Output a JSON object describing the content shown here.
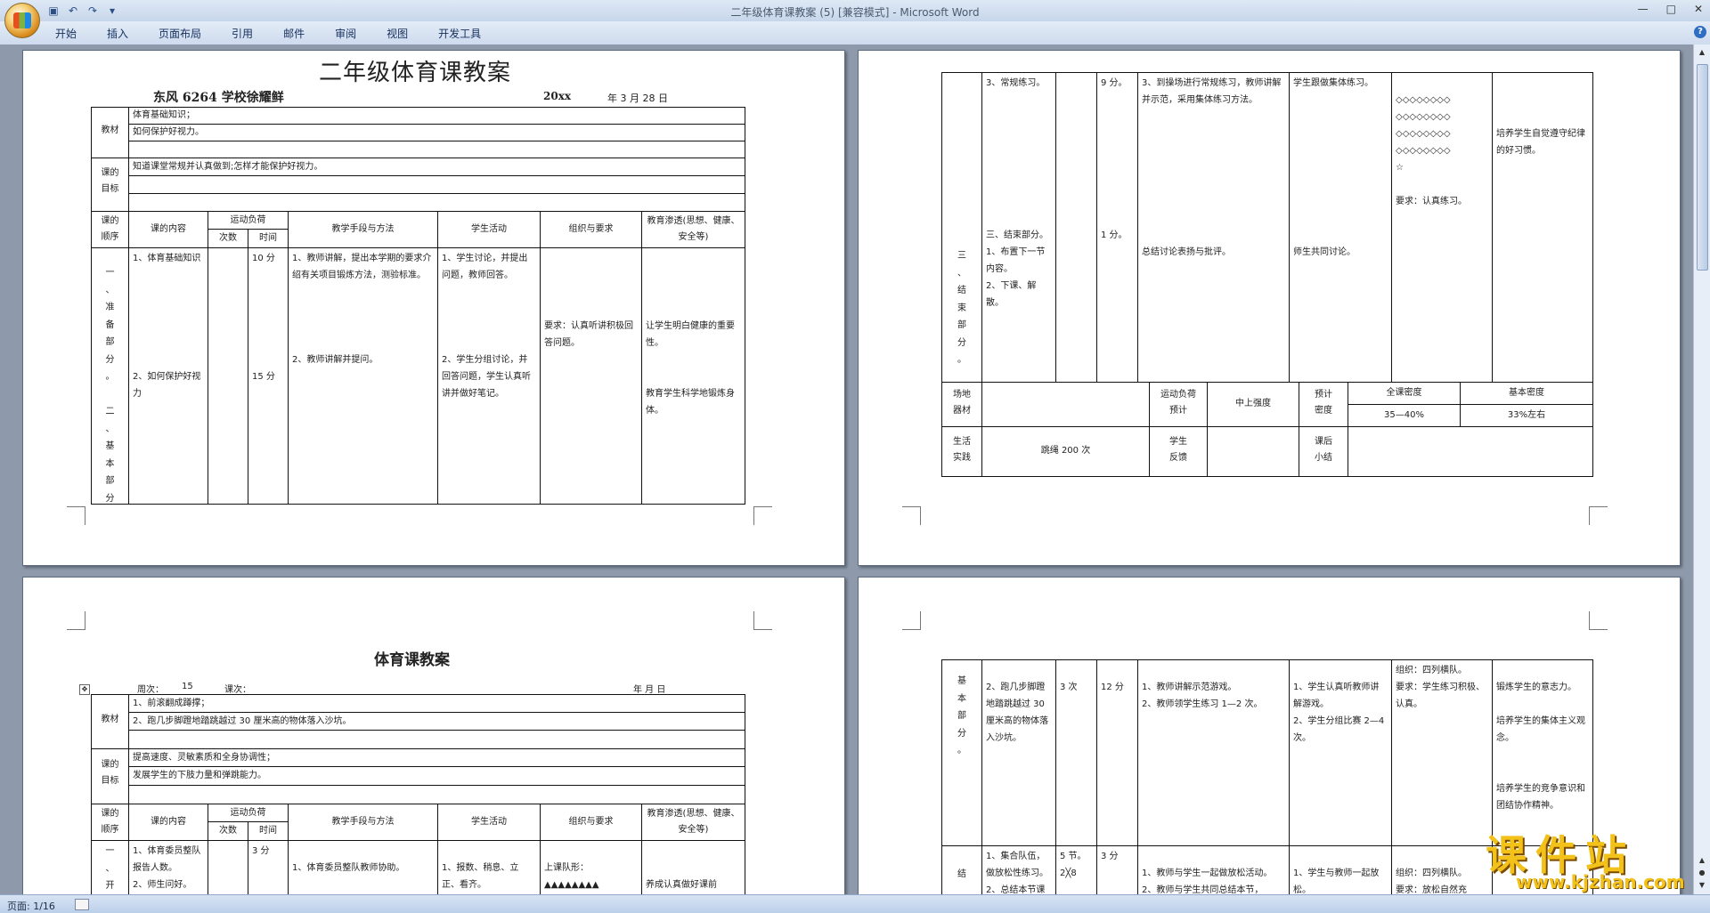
{
  "app": {
    "title": "二年级体育课教案 (5) [兼容模式] - Microsoft Word",
    "tabs": [
      "开始",
      "插入",
      "页面布局",
      "引用",
      "邮件",
      "审阅",
      "视图",
      "开发工具"
    ]
  },
  "status": {
    "page": "页面: 1/16"
  },
  "watermark": {
    "text": "课件站",
    "url": "www.kjzhan.com"
  },
  "p1": {
    "title": "二年级体育课教案",
    "school": "东风 6264 学校徐耀鲜",
    "date_year": "20xx",
    "date_rest": "年 3    月 28   日",
    "jiaocai_label": "教材",
    "jiaocai": [
      "体育基础知识；",
      "如何保护好视力。"
    ],
    "mubiao_label": "课的\n目标",
    "mubiao": [
      "知道课堂常规并认真做到;怎样才能保护好视力。"
    ],
    "headers": {
      "order": "课的\n顺序",
      "content": "课的内容",
      "load": "运动负荷",
      "times": "次数",
      "duration": "时间",
      "method": "教学手段与方法",
      "student": "学生活动",
      "org": "组织与要求",
      "edu": "教育渗透(思想、健康、安全等)"
    },
    "col_order": "一\n、\n准\n备\n部\n分\n。\n\n二\n、\n基\n本\n部\n分\n。",
    "col_content": "1、体育基础知识\n\n\n\n\n\n\n2、如何保护好视力",
    "col_duration": "10 分\n\n\n\n\n\n\n15 分",
    "col_method": "1、教师讲解，提出本学期的要求介绍有关项目锻炼方法，测验标准。\n\n\n\n\n2、教师讲解并提问。",
    "col_student": "1、学生讨论，并提出问题，教师回答。\n\n\n\n\n2、学生分组讨论，并回答问题，学生认真听讲并做好笔记。",
    "col_org": "\n\n\n\n要求：认真听讲积极回答问题。",
    "col_edu": "\n\n\n\n让学生明白健康的重要性。\n\n\n教育学生科学地锻炼身体。"
  },
  "p2": {
    "col_order": "三\n、\n结\n束\n部\n分\n。",
    "col_content": "3、常规练习。\n\n\n\n\n\n\n\n\n三、结束部分。\n1、布置下一节内容。\n2、下课、解散。",
    "col_duration": "9 分。\n\n\n\n\n\n\n\n\n1 分。",
    "col_method": "3、到操场进行常规练习，教师讲解并示范，采用集体练习方法。\n\n\n\n\n\n\n\n\n总结讨论表扬与批评。",
    "col_student": "学生跟做集体练习。\n\n\n\n\n\n\n\n\n\n师生共同讨论。",
    "col_org": "\n◇◇◇◇◇◇◇◇\n◇◇◇◇◇◇◇◇\n◇◇◇◇◇◇◇◇\n◇◇◇◇◇◇◇◇\n☆\n\n要求：认真练习。",
    "col_edu": "\n\n\n培养学生自觉遵守纪律的好习惯。",
    "equipment_label": "场地\n器材",
    "load_label": "运动负荷\n预计",
    "load_value": "中上强度",
    "density_label": "预计\n密度",
    "overall_density_label": "全课密度",
    "basic_density_label": "基本密度",
    "overall_density": "35—40%",
    "basic_density": "33%左右",
    "life_label": "生活\n实践",
    "life_value": "跳绳 200 次",
    "feedback_label": "学生\n反馈",
    "reflection_label": "课后\n小结"
  },
  "p3": {
    "title": "体育课教案",
    "week_label": "周次：",
    "week_value": "15",
    "lesson_label": "课次：",
    "date_label": "年     月     日",
    "jiaocai_label": "教材",
    "jiaocai": [
      "1、前滚翻成蹲撑；",
      "2、跑几步脚蹬地踏跳越过 30 厘米高的物体落入沙坑。"
    ],
    "mubiao_label": "课的\n目标",
    "mubiao": [
      "提高速度、灵敏素质和全身协调性；",
      "发展学生的下肢力量和弹跳能力。"
    ],
    "col_order": "一\n、\n开\n始",
    "col_content": "1、体育委员整队报告人数。\n2、师生问好。",
    "col_duration": "3 分",
    "col_method": "\n1、体育委员整队教师协助。",
    "col_student": "\n1、报数、稍息、立正、看齐。",
    "col_org": "\n上课队形：\n▲▲▲▲▲▲▲▲",
    "col_edu": "\n\n养成认真做好课前"
  },
  "p4": {
    "col_order": "基\n本\n部\n分\n。",
    "col_content": "\n2、跑几步脚蹬地踏跳越过 30 厘米高的物体落入沙坑。",
    "col_times": "\n3 次",
    "col_duration": "\n12 分",
    "col_method": "\n1、教师讲解示范游戏。\n2、教师领学生练习 1—2 次。",
    "col_student": "\n1、学生认真听教师讲解游戏。\n2、学生分组比赛 2—4 次。",
    "col_org": "组织：四列横队。\n要求：学生练习积极、认真。",
    "col_edu": "\n锻炼学生的意志力。\n\n培养学生的集体主义观念。\n\n\n培养学生的竞争意识和团结协作精神。",
    "end_order": "\n结",
    "end_content": "1、集合队伍，做放松性练习。\n2、总结本节课",
    "end_times": "5 节。\n2╳8",
    "end_duration": "3 分",
    "end_method": "\n1、教师与学生一起做放松活动。\n2、教师与学生共同总结本节，",
    "end_student": "\n1、学生与教师一起放松。",
    "end_org": "\n组织：四列横队。\n要求：放松自然充",
    "end_edu": ""
  }
}
